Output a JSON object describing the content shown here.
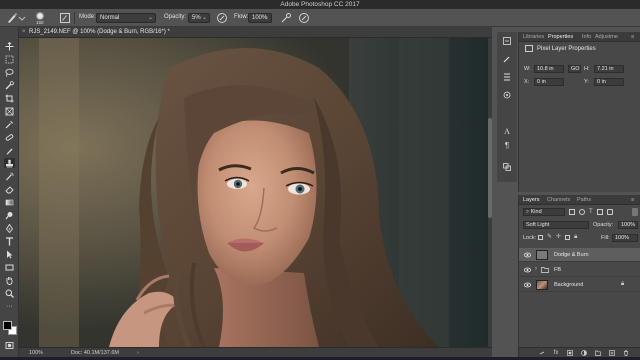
{
  "app": {
    "title": "Adobe Photoshop CC 2017"
  },
  "options_bar": {
    "brush_size": "150",
    "mode_label": "Mode:",
    "mode_value": "Normal",
    "opacity_label": "Opacity:",
    "opacity_value": "5%",
    "flow_label": "Flow:",
    "flow_value": "100%"
  },
  "document": {
    "tab_title": "RJS_2149.NEF @ 100% (Dodge & Burn, RGB/16*) *",
    "zoom": "100%",
    "doc_info": "Doc: 40.1M/137.6M"
  },
  "properties_panel": {
    "tabs": [
      "Libraries",
      "Properties",
      "Info",
      "Adjustme"
    ],
    "active_tab": "Properties",
    "title": "Pixel Layer Properties",
    "w_label": "W:",
    "w_value": "10.8 in",
    "link_label": "GO",
    "h_label": "H:",
    "h_value": "7.21 in",
    "x_label": "X:",
    "x_value": "0 in",
    "y_label": "Y:",
    "y_value": "0 in"
  },
  "layers_panel": {
    "tabs": [
      "Layers",
      "Channels",
      "Paths"
    ],
    "active_tab": "Layers",
    "filter_label": "Kind",
    "blend_mode": "Soft Light",
    "opacity_label": "Opacity:",
    "opacity_value": "100%",
    "lock_label": "Lock:",
    "fill_label": "Fill:",
    "fill_value": "100%",
    "layers": [
      {
        "name": "Dodge & Burn",
        "selected": true,
        "type": "pixel"
      },
      {
        "name": "FB",
        "selected": false,
        "type": "group"
      },
      {
        "name": "Background",
        "selected": false,
        "type": "image",
        "locked": true
      }
    ]
  },
  "colors": {
    "ui_bg": "#535353",
    "panel_bg": "#484848",
    "selected_layer": "#5e5e5e",
    "fg_swatch": "#000000",
    "bg_swatch": "#ffffff"
  }
}
